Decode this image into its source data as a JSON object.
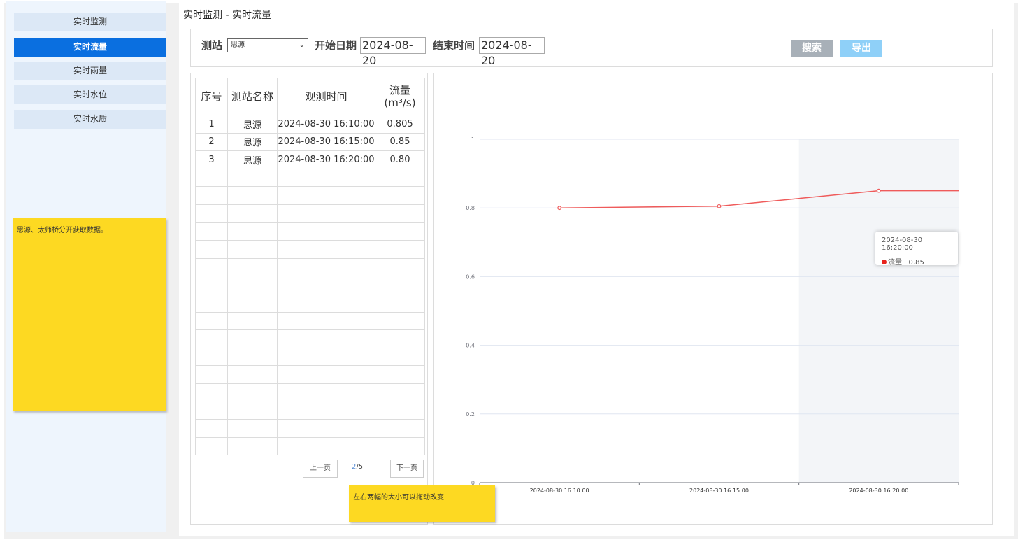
{
  "sidebar": {
    "items": [
      {
        "label": "实时监测",
        "active": false
      },
      {
        "label": "实时流量",
        "active": true
      },
      {
        "label": "实时雨量",
        "active": false
      },
      {
        "label": "实时水位",
        "active": false
      },
      {
        "label": "实时水质",
        "active": false
      }
    ]
  },
  "notes": {
    "sidebar_note": "思源、太师桥分开获取数据。",
    "resize_note": "左右两幅的大小可以拖动改变"
  },
  "page": {
    "title": "实时监测 - 实时流量"
  },
  "search": {
    "station_label": "测站",
    "station_value": "思源",
    "start_label": "开始日期",
    "start_value": "2024-08-20",
    "end_label": "结束时间",
    "end_value": "2024-08-20",
    "search_button": "搜索",
    "export_button": "导出"
  },
  "table": {
    "headers": [
      "序号",
      "测站名称",
      "观测时间",
      "流量 (m³/s)"
    ],
    "rows": [
      [
        "1",
        "思源",
        "2024-08-30 16:10:00",
        "0.805"
      ],
      [
        "2",
        "思源",
        "2024-08-30 16:15:00",
        "0.85"
      ],
      [
        "3",
        "思源",
        "2024-08-30 16:20:00",
        "0.80"
      ]
    ],
    "empty_rows": 16
  },
  "pager": {
    "prev_label": "上一页",
    "current": "2",
    "total": "/5",
    "next_label": "下一页"
  },
  "tooltip": {
    "time": "2024-08-30 16:20:00",
    "series": "流量",
    "value": "0.85"
  },
  "chart_data": {
    "type": "line",
    "x": [
      "2024-08-30 16:10:00",
      "2024-08-30 16:15:00",
      "2024-08-30 16:20:00"
    ],
    "series": [
      {
        "name": "流量",
        "values": [
          0.8,
          0.805,
          0.85
        ],
        "color": "#ef5b5b"
      }
    ],
    "ylim": [
      0,
      1
    ],
    "yticks": [
      0,
      0.2,
      0.4,
      0.6,
      0.8,
      1
    ],
    "ytick_labels": [
      "0",
      "0.2",
      "0.4",
      "0.6",
      "0.8",
      "1"
    ],
    "grid": true,
    "highlighted_category": "2024-08-30 16:20:00"
  },
  "colors": {
    "accent": "#0a6fe0",
    "note": "#fdd922",
    "line": "#ef5b5b",
    "tooltip_dot": "#e8231c"
  }
}
